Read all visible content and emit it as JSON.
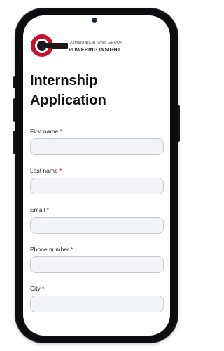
{
  "brand": {
    "line1": "COMMUNICATIONS GROUP",
    "line2": "POWERING INSIGHT",
    "accent_color": "#d11b2a"
  },
  "page_title_lines": [
    "Internship",
    "Application"
  ],
  "required_marker": "*",
  "fields": [
    {
      "label": "First name",
      "value": "",
      "placeholder": ""
    },
    {
      "label": "Last name",
      "value": "",
      "placeholder": ""
    },
    {
      "label": "Email",
      "value": "",
      "placeholder": ""
    },
    {
      "label": "Phone number",
      "value": "",
      "placeholder": ""
    },
    {
      "label": "City",
      "value": "",
      "placeholder": ""
    }
  ]
}
